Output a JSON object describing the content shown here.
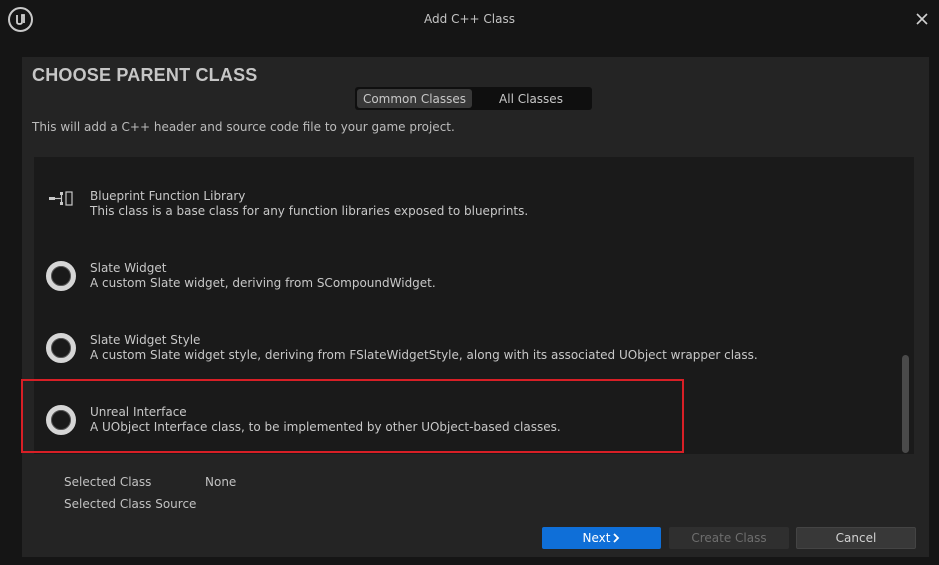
{
  "window": {
    "title": "Add C++ Class",
    "logo_icon": "unreal-engine-logo-icon",
    "close_icon": "close-icon"
  },
  "header": {
    "heading": "CHOOSE PARENT CLASS",
    "subtitle": "This will add a C++ header and source code file to your game project."
  },
  "tabs": [
    {
      "label": "Common Classes",
      "selected": true
    },
    {
      "label": "All Classes",
      "selected": false
    }
  ],
  "classes": [
    {
      "name": "Blueprint Function Library",
      "description": "This class is a base class for any function libraries exposed to blueprints.",
      "icon": "blueprint-function-library-icon"
    },
    {
      "name": "Slate Widget",
      "description": "A custom Slate widget, deriving from SCompoundWidget.",
      "icon": "circle-class-icon"
    },
    {
      "name": "Slate Widget Style",
      "description": "A custom Slate widget style, deriving from FSlateWidgetStyle, along with its associated UObject wrapper class.",
      "icon": "circle-class-icon"
    },
    {
      "name": "Unreal Interface",
      "description": "A UObject Interface class, to be implemented by other UObject-based classes.",
      "icon": "circle-class-icon",
      "highlighted": true
    }
  ],
  "selection": {
    "selected_class_label": "Selected Class",
    "selected_class_value": "None",
    "selected_source_label": "Selected Class Source"
  },
  "buttons": {
    "next": "Next",
    "next_icon": "chevron-right-icon",
    "create": "Create Class",
    "cancel": "Cancel"
  },
  "colors": {
    "accent": "#0f6fd8",
    "highlight": "#d81f26"
  }
}
